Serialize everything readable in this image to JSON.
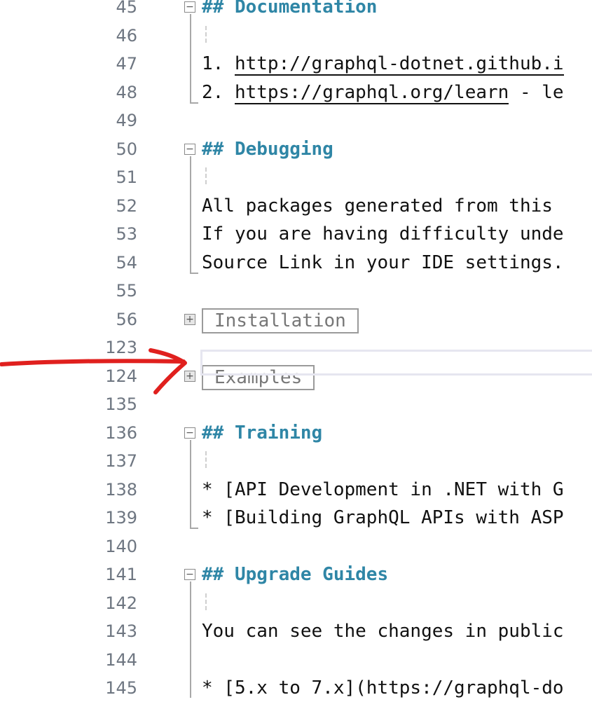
{
  "editor": {
    "lines": [
      {
        "num": "45",
        "text": "## Documentation",
        "kind": "heading"
      },
      {
        "num": "46",
        "text": "",
        "kind": "blank"
      },
      {
        "num": "47",
        "pre": "1. ",
        "link": "http://graphql-dotnet.github.i",
        "post": "",
        "kind": "link"
      },
      {
        "num": "48",
        "pre": "2. ",
        "link": "https://graphql.org/learn",
        "post": " - le",
        "kind": "link"
      },
      {
        "num": "49",
        "text": "",
        "kind": "blank"
      },
      {
        "num": "50",
        "text": "## Debugging",
        "kind": "heading"
      },
      {
        "num": "51",
        "text": "",
        "kind": "blank"
      },
      {
        "num": "52",
        "text": "All packages generated from this",
        "kind": "text"
      },
      {
        "num": "53",
        "text": "If you are having difficulty unde",
        "kind": "text"
      },
      {
        "num": "54",
        "text": "Source Link in your IDE settings.",
        "kind": "text"
      },
      {
        "num": "55",
        "text": "",
        "kind": "blank"
      },
      {
        "num": "56",
        "text": "Installation",
        "kind": "collapsed"
      },
      {
        "num": "123",
        "text": "",
        "kind": "current"
      },
      {
        "num": "124",
        "text": "Examples",
        "kind": "collapsed"
      },
      {
        "num": "135",
        "text": "",
        "kind": "blank"
      },
      {
        "num": "136",
        "text": "## Training",
        "kind": "heading"
      },
      {
        "num": "137",
        "text": "",
        "kind": "blank"
      },
      {
        "num": "138",
        "text": "* [API Development in .NET with G",
        "kind": "text"
      },
      {
        "num": "139",
        "text": "* [Building GraphQL APIs with ASP",
        "kind": "text"
      },
      {
        "num": "140",
        "text": "",
        "kind": "blank"
      },
      {
        "num": "141",
        "text": "## Upgrade Guides",
        "kind": "heading"
      },
      {
        "num": "142",
        "text": "",
        "kind": "blank"
      },
      {
        "num": "143",
        "text": "You can see the changes in public",
        "kind": "text"
      },
      {
        "num": "144",
        "text": "",
        "kind": "blank"
      },
      {
        "num": "145",
        "text": "* [5.x to 7.x](https://graphql-do",
        "kind": "text"
      }
    ],
    "fold_expanded_glyph": "−",
    "fold_collapsed_glyph": "+"
  },
  "colors": {
    "heading": "#2f86a6",
    "line_number": "#6e7681",
    "annotation_arrow": "#e0201e"
  }
}
